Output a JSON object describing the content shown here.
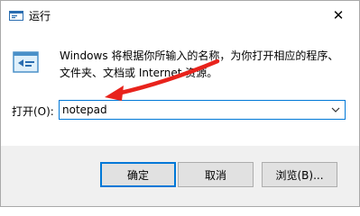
{
  "window": {
    "title": "运行",
    "close_symbol": "✕"
  },
  "dialog": {
    "description": "Windows 将根据你所输入的名称，为你打开相应的程序、文件夹、文档或 Internet 资源。",
    "open_label": "打开(O):",
    "input_value": "notepad"
  },
  "buttons": {
    "ok": "确定",
    "cancel": "取消",
    "browse": "浏览(B)..."
  },
  "colors": {
    "accent": "#0078d7",
    "annotation_arrow": "#e8231c"
  }
}
